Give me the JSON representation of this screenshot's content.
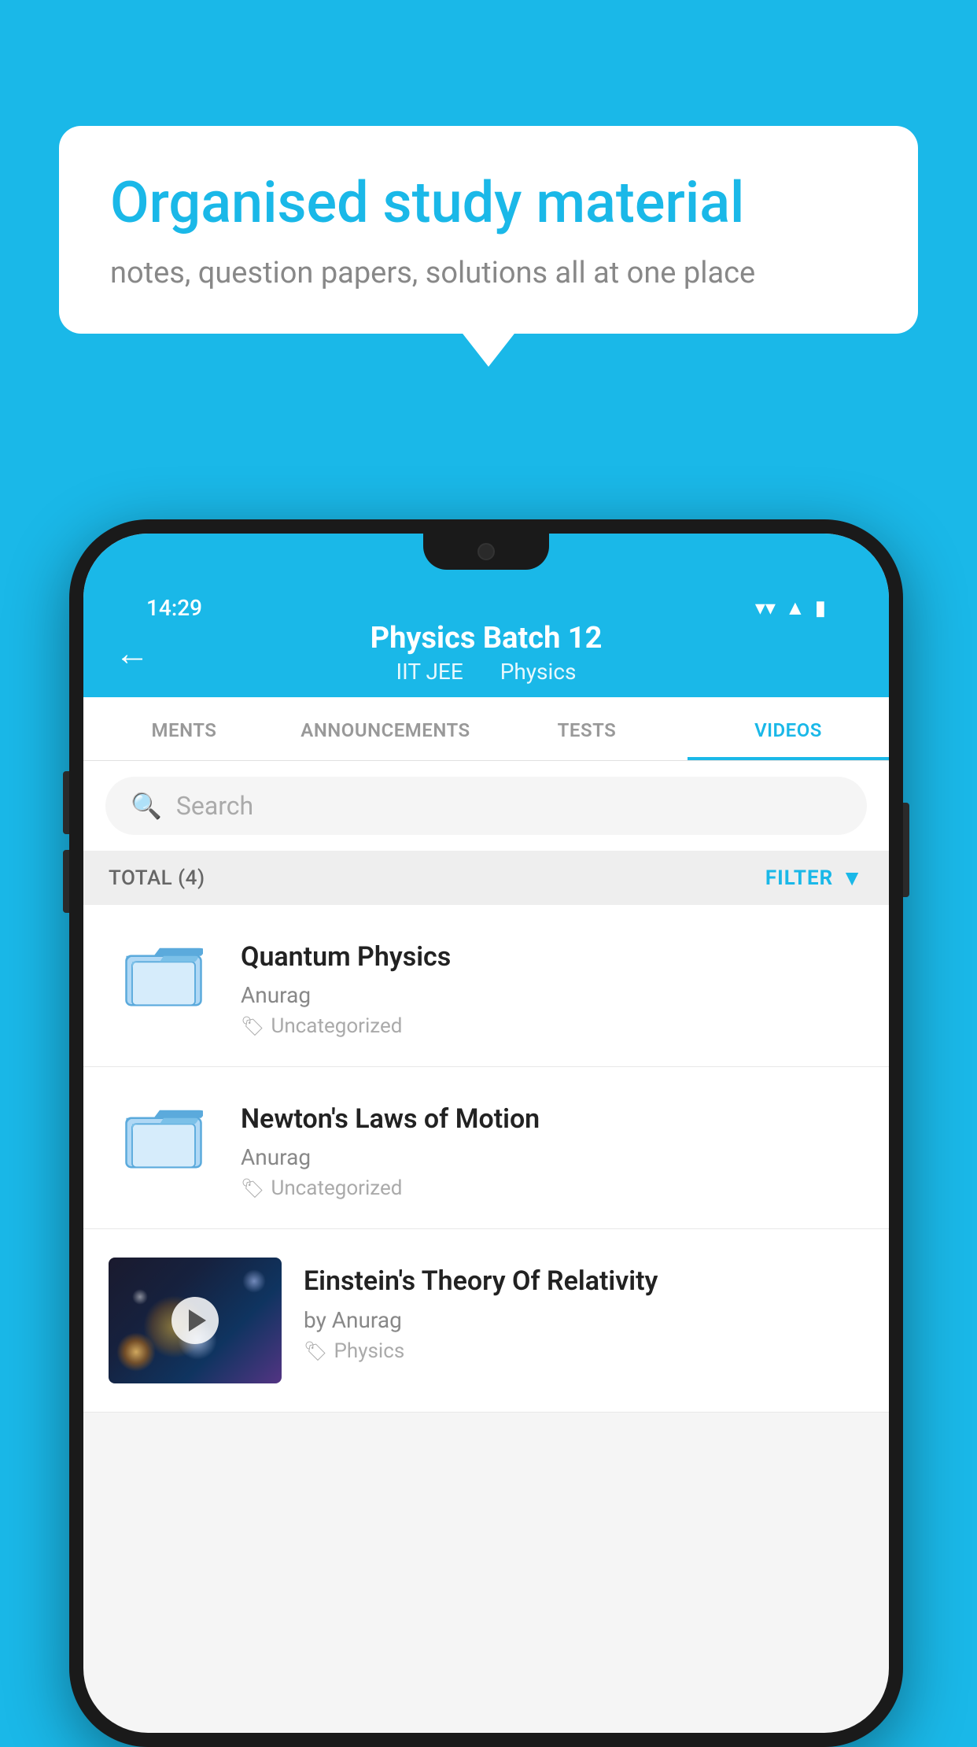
{
  "background": {
    "color": "#1ab8e8"
  },
  "speech_bubble": {
    "title": "Organised study material",
    "subtitle": "notes, question papers, solutions all at one place"
  },
  "phone": {
    "status_bar": {
      "time": "14:29",
      "icons": [
        "wifi",
        "signal",
        "battery"
      ]
    },
    "header": {
      "back_label": "←",
      "title": "Physics Batch 12",
      "subtitle_parts": [
        "IIT JEE",
        "Physics"
      ]
    },
    "tabs": [
      {
        "label": "MENTS",
        "active": false
      },
      {
        "label": "ANNOUNCEMENTS",
        "active": false
      },
      {
        "label": "TESTS",
        "active": false
      },
      {
        "label": "VIDEOS",
        "active": true
      }
    ],
    "search": {
      "placeholder": "Search"
    },
    "filter_bar": {
      "total_label": "TOTAL (4)",
      "filter_label": "FILTER"
    },
    "videos": [
      {
        "id": 1,
        "title": "Quantum Physics",
        "author": "Anurag",
        "tag": "Uncategorized",
        "type": "folder",
        "has_thumbnail": false
      },
      {
        "id": 2,
        "title": "Newton's Laws of Motion",
        "author": "Anurag",
        "tag": "Uncategorized",
        "type": "folder",
        "has_thumbnail": false
      },
      {
        "id": 3,
        "title": "Einstein's Theory Of Relativity",
        "author": "by Anurag",
        "tag": "Physics",
        "type": "video",
        "has_thumbnail": true
      }
    ]
  }
}
